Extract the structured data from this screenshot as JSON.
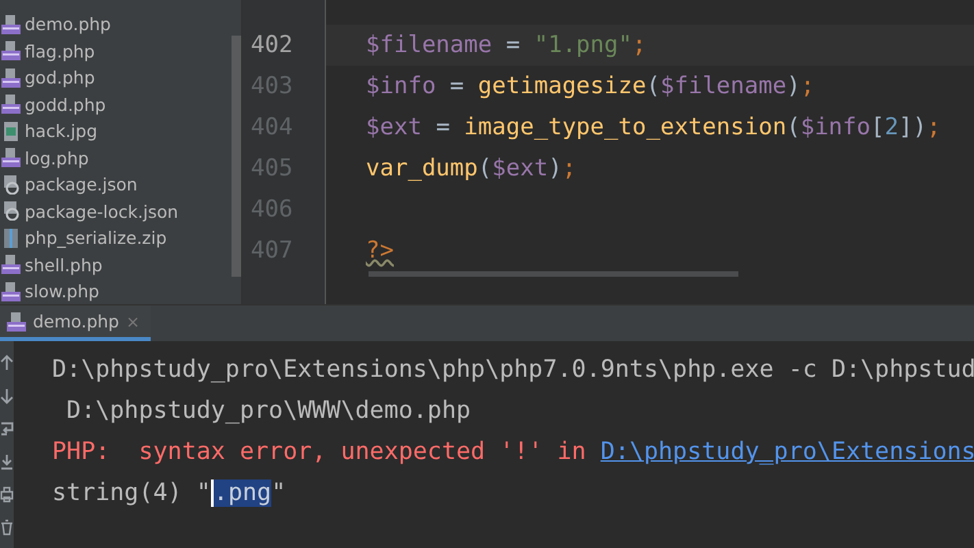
{
  "project_tree": {
    "files": [
      {
        "name": "demo.php",
        "kind": "php"
      },
      {
        "name": "flag.php",
        "kind": "php"
      },
      {
        "name": "god.php",
        "kind": "php"
      },
      {
        "name": "godd.php",
        "kind": "php"
      },
      {
        "name": "hack.jpg",
        "kind": "image"
      },
      {
        "name": "log.php",
        "kind": "php"
      },
      {
        "name": "package.json",
        "kind": "json"
      },
      {
        "name": "package-lock.json",
        "kind": "json"
      },
      {
        "name": "php_serialize.zip",
        "kind": "zip"
      },
      {
        "name": "shell.php",
        "kind": "php"
      },
      {
        "name": "slow.php",
        "kind": "php"
      }
    ]
  },
  "editor": {
    "lines": [
      {
        "number": "402",
        "current": true,
        "tokens": [
          {
            "text": "$filename",
            "kind": "var"
          },
          {
            "text": " = ",
            "kind": "op"
          },
          {
            "text": "\"1.png\"",
            "kind": "str"
          },
          {
            "text": ";",
            "kind": "punc"
          }
        ]
      },
      {
        "number": "403",
        "current": false,
        "tokens": [
          {
            "text": "$info",
            "kind": "var"
          },
          {
            "text": " = ",
            "kind": "op"
          },
          {
            "text": "getimagesize",
            "kind": "fn"
          },
          {
            "text": "(",
            "kind": "op"
          },
          {
            "text": "$filename",
            "kind": "var"
          },
          {
            "text": ")",
            "kind": "op"
          },
          {
            "text": ";",
            "kind": "punc"
          }
        ]
      },
      {
        "number": "404",
        "current": false,
        "tokens": [
          {
            "text": "$ext",
            "kind": "var"
          },
          {
            "text": " = ",
            "kind": "op"
          },
          {
            "text": "image_type_to_extension",
            "kind": "fn"
          },
          {
            "text": "(",
            "kind": "op"
          },
          {
            "text": "$info",
            "kind": "var"
          },
          {
            "text": "[",
            "kind": "op"
          },
          {
            "text": "2",
            "kind": "num"
          },
          {
            "text": "])",
            "kind": "op"
          },
          {
            "text": ";",
            "kind": "punc"
          }
        ]
      },
      {
        "number": "405",
        "current": false,
        "tokens": [
          {
            "text": "var_dump",
            "kind": "fn"
          },
          {
            "text": "(",
            "kind": "op"
          },
          {
            "text": "$ext",
            "kind": "var"
          },
          {
            "text": ")",
            "kind": "op"
          },
          {
            "text": ";",
            "kind": "punc"
          }
        ]
      },
      {
        "number": "406",
        "current": false
      },
      {
        "number": "407",
        "current": false,
        "tokens": [
          {
            "text": "?>",
            "kind": "tag"
          }
        ]
      }
    ]
  },
  "run_panel": {
    "tab": {
      "label": "demo.php",
      "close": "×",
      "selected": true
    },
    "console": [
      {
        "kind": "plain",
        "text": "D:\\phpstudy_pro\\Extensions\\php\\php7.0.9nts\\php.exe -c D:\\phpstud"
      },
      {
        "kind": "plain",
        "text": " D:\\phpstudy_pro\\WWW\\demo.php"
      },
      {
        "kind": "error",
        "text": "PHP:  syntax error, unexpected '!' in ",
        "link_text": "D:\\phpstudy_pro\\Extensions"
      },
      {
        "kind": "plain",
        "text": "string(4) \"",
        "selected_text": ".png",
        "trailing": "\""
      }
    ]
  }
}
